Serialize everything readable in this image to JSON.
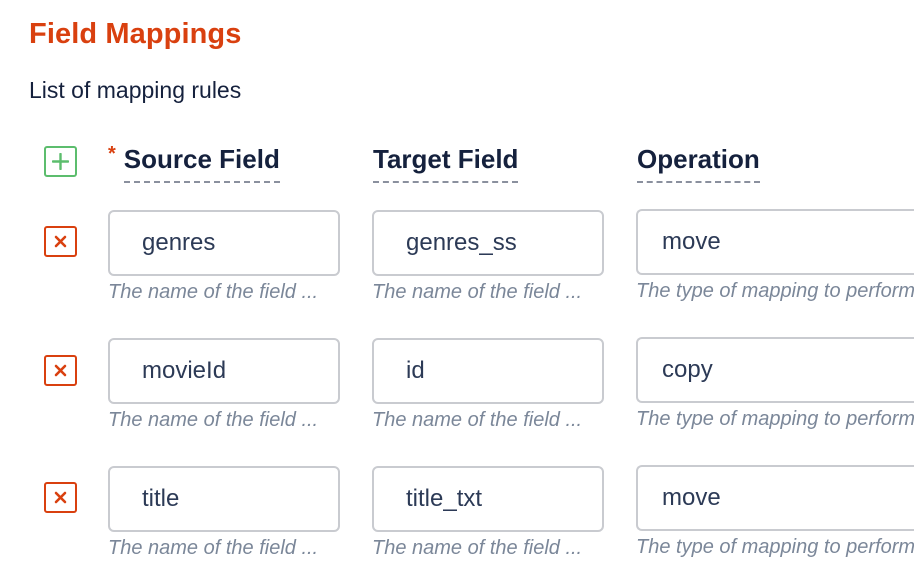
{
  "section": {
    "title": "Field Mappings",
    "description": "List of mapping rules"
  },
  "header": {
    "add_icon": "plus-icon",
    "required_mark": "*",
    "columns": [
      {
        "label": "Source Field",
        "required": true
      },
      {
        "label": "Target Field",
        "required": false
      },
      {
        "label": "Operation",
        "required": false
      }
    ]
  },
  "rows": [
    {
      "remove_icon": "close-icon",
      "source": "genres",
      "target": "genres_ss",
      "operation": "move",
      "source_help": "The name of the field ...",
      "target_help": "The name of the field ...",
      "operation_help": "The type of mapping to perform"
    },
    {
      "remove_icon": "close-icon",
      "source": "movieId",
      "target": "id",
      "operation": "copy",
      "source_help": "The name of the field ...",
      "target_help": "The name of the field ...",
      "operation_help": "The type of mapping to perform"
    },
    {
      "remove_icon": "close-icon",
      "source": "title",
      "target": "title_txt",
      "operation": "move",
      "source_help": "The name of the field ...",
      "target_help": "The name of the field ...",
      "operation_help": "The type of mapping to perform"
    }
  ],
  "colors": {
    "accent": "#d9400f",
    "add": "#5cbd6d",
    "text": "#15213d",
    "helper": "#7b8799",
    "border": "#c9cbd0"
  }
}
